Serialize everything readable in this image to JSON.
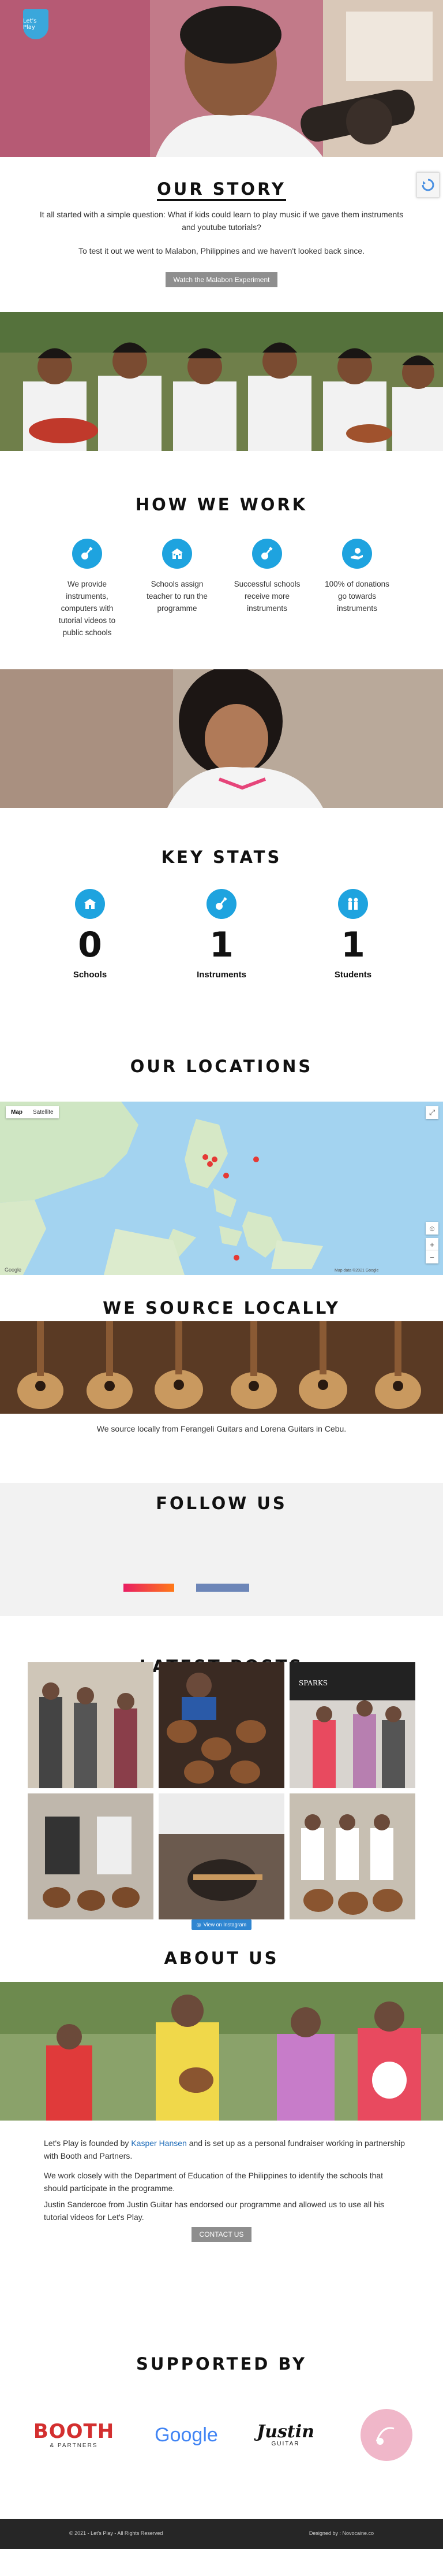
{
  "hero": {
    "logo_text": "Let's Play"
  },
  "story": {
    "title": "OUR STORY",
    "paragraph_1": "It all started with a simple question: What if kids could learn to play music if we gave them instruments and youtube tutorials?",
    "paragraph_2": "To test it out we went to Malabon, Philippines and we haven't looked back since.",
    "button_label": "Watch the Malabon Experiment"
  },
  "how_we_work": {
    "title": "HOW WE WORK",
    "items": [
      {
        "icon": "guitar-icon",
        "text": "We provide instruments, computers with tutorial videos to public schools"
      },
      {
        "icon": "school-icon",
        "text": "Schools assign teacher to run the programme"
      },
      {
        "icon": "guitar-icon",
        "text": "Successful schools receive more instruments"
      },
      {
        "icon": "donation-icon",
        "text": "100% of donations go towards instruments"
      }
    ]
  },
  "key_stats": {
    "title": "KEY STATS",
    "items": [
      {
        "icon": "school-icon",
        "value": "0",
        "label": "Schools"
      },
      {
        "icon": "guitar-icon",
        "value": "1",
        "label": "Instruments"
      },
      {
        "icon": "students-icon",
        "value": "1",
        "label": "Students"
      }
    ]
  },
  "locations": {
    "title": "OUR LOCATIONS",
    "map_tabs": [
      "Map",
      "Satellite"
    ],
    "map_credit": "Map data ©2021 Google"
  },
  "source": {
    "title": "WE SOURCE LOCALLY",
    "text": "We source locally from Ferangeli Guitars and Lorena Guitars in Cebu."
  },
  "follow": {
    "title": "FOLLOW US",
    "instagram_color": "#e91e63",
    "facebook_color": "#6d86b8"
  },
  "posts": {
    "title": "LATEST POSTS",
    "instagram_button": "View on Instagram"
  },
  "about": {
    "title": "ABOUT US",
    "p1_before": "Let's Play is founded by ",
    "p1_link": "Kasper Hansen",
    "p1_after": " and is set up as a personal fundraiser working in partnership with Booth and Partners.",
    "p2": "We work closely with the Department of Education of the Philippines to identify the schools that should participate in the programme.",
    "p3": "Justin Sandercoe from Justin Guitar has endorsed our programme and allowed us to use all his tutorial videos for Let's Play.",
    "button_label": "CONTACT US"
  },
  "supported_by": {
    "title": "SUPPORTED BY",
    "logos": {
      "booth": "BOOTH",
      "booth_sub": "& PARTNERS",
      "google": "Google",
      "justin": "Justin",
      "justin_sub": "GUITAR"
    }
  },
  "footer": {
    "copyright": "© 2021 - Let's Play - All Rights Reserved",
    "designed_by": "Designed by : Novocaine.co"
  },
  "colors": {
    "accent": "#1ea3df",
    "button_grey": "#8e8e8e",
    "instagram_blue": "#2f86d1",
    "footer_bg": "#262626"
  }
}
